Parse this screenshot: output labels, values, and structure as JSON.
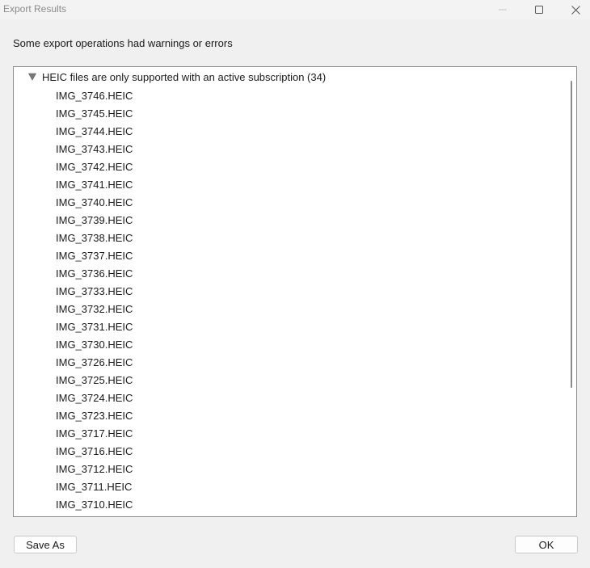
{
  "window": {
    "title": "Export Results",
    "controls": [
      "minimize",
      "maximize",
      "close"
    ]
  },
  "message": "Some export operations had warnings or errors",
  "tree": {
    "group": {
      "label": "HEIC files are only supported with an active subscription (34)",
      "expanded": true,
      "items": [
        "IMG_3746.HEIC",
        "IMG_3745.HEIC",
        "IMG_3744.HEIC",
        "IMG_3743.HEIC",
        "IMG_3742.HEIC",
        "IMG_3741.HEIC",
        "IMG_3740.HEIC",
        "IMG_3739.HEIC",
        "IMG_3738.HEIC",
        "IMG_3737.HEIC",
        "IMG_3736.HEIC",
        "IMG_3733.HEIC",
        "IMG_3732.HEIC",
        "IMG_3731.HEIC",
        "IMG_3730.HEIC",
        "IMG_3726.HEIC",
        "IMG_3725.HEIC",
        "IMG_3724.HEIC",
        "IMG_3723.HEIC",
        "IMG_3717.HEIC",
        "IMG_3716.HEIC",
        "IMG_3712.HEIC",
        "IMG_3711.HEIC",
        "IMG_3710.HEIC"
      ]
    }
  },
  "buttons": {
    "save_as": "Save As",
    "ok": "OK"
  }
}
